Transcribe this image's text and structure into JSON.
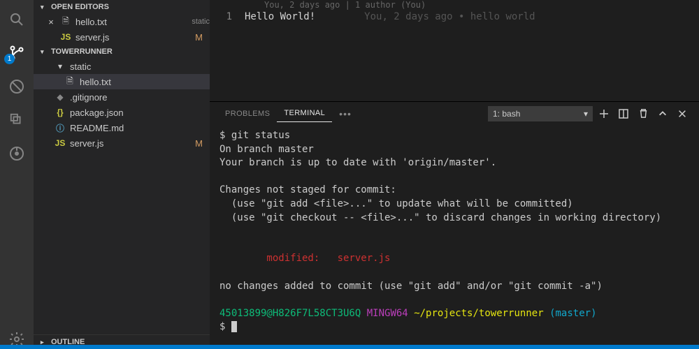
{
  "activity": {
    "badge": "1"
  },
  "sidebar": {
    "open_editors_label": "OPEN EDITORS",
    "open_editors": [
      {
        "name": "hello.txt",
        "tag": "static",
        "icon": "file",
        "closable": true
      },
      {
        "name": "server.js",
        "tag": "",
        "icon": "js",
        "mod": "M"
      }
    ],
    "project_label": "TOWERRUNNER",
    "tree": [
      {
        "name": "static",
        "icon": "folder-open",
        "lvl": 1,
        "chev": "▾"
      },
      {
        "name": "hello.txt",
        "icon": "file",
        "lvl": 2,
        "sel": true
      },
      {
        "name": ".gitignore",
        "icon": "git",
        "lvl": 1
      },
      {
        "name": "package.json",
        "icon": "braces",
        "lvl": 1
      },
      {
        "name": "README.md",
        "icon": "info",
        "lvl": 1
      },
      {
        "name": "server.js",
        "icon": "js",
        "lvl": 1,
        "mod": "M"
      }
    ],
    "outline_label": "OUTLINE"
  },
  "editor": {
    "blame_header": "You, 2 days ago | 1 author (You)",
    "line_no": "1",
    "content": "Hello World!",
    "lens": "You, 2 days ago • hello world"
  },
  "panel": {
    "tabs": [
      "PROBLEMS",
      "TERMINAL"
    ],
    "active_tab": 1,
    "dropdown": "1: bash"
  },
  "terminal": {
    "lines": [
      {
        "t": "$ git status"
      },
      {
        "t": "On branch master"
      },
      {
        "t": "Your branch is up to date with 'origin/master'."
      },
      {
        "t": ""
      },
      {
        "t": "Changes not staged for commit:"
      },
      {
        "t": "  (use \"git add <file>...\" to update what will be committed)"
      },
      {
        "t": "  (use \"git checkout -- <file>...\" to discard changes in working directory)"
      },
      {
        "t": ""
      },
      {
        "t": ""
      },
      {
        "t": "        modified:   server.js",
        "cls": "t-red"
      },
      {
        "t": ""
      },
      {
        "t": "no changes added to commit (use \"git add\" and/or \"git commit -a\")"
      },
      {
        "t": ""
      }
    ],
    "prompt": {
      "user": "45013899@H826F7L58CT3U6Q",
      "shell": "MINGW64",
      "path": "~/projects/towerrunner",
      "branch": "(master)",
      "ps": "$ "
    }
  }
}
